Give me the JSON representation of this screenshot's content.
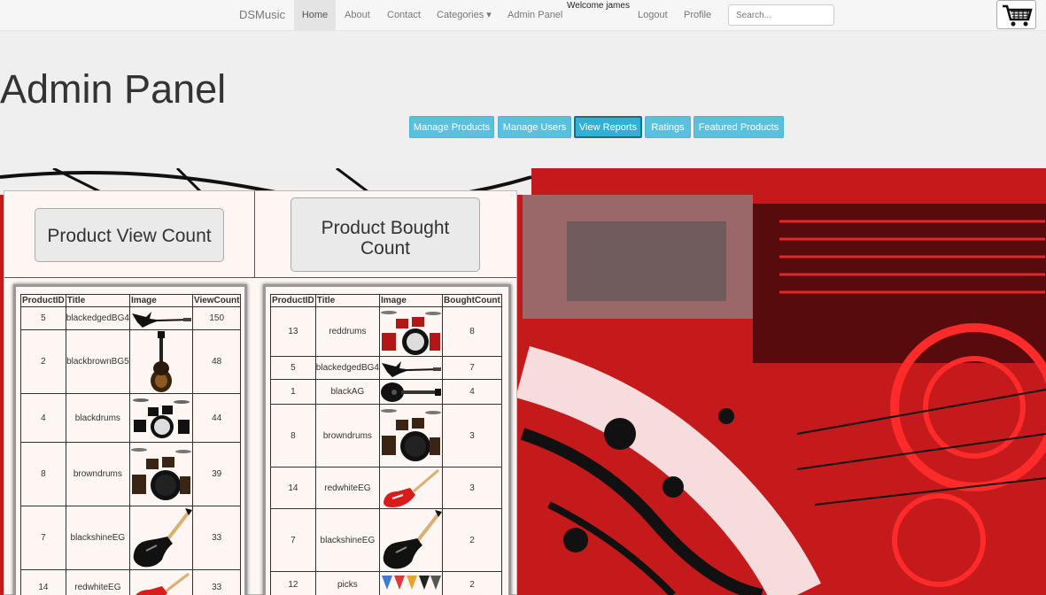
{
  "nav": {
    "brand": "DSMusic",
    "items": [
      {
        "label": "Home"
      },
      {
        "label": "About"
      },
      {
        "label": "Contact"
      },
      {
        "label": "Categories ▾"
      },
      {
        "label": "Admin Panel"
      },
      {
        "label": "Logout"
      },
      {
        "label": "Profile"
      }
    ],
    "welcome": "Welcome james",
    "search_placeholder": "Search..."
  },
  "header": {
    "title": "Admin Panel",
    "buttons": [
      {
        "label": "Manage Products"
      },
      {
        "label": "Manage Users"
      },
      {
        "label": "View Reports"
      },
      {
        "label": "Ratings"
      },
      {
        "label": "Featured Products"
      }
    ]
  },
  "reports": {
    "view_button": "Product View Count",
    "bought_button_line1": "Product Bought",
    "bought_button_line2": "Count",
    "view_table": {
      "headers": [
        "ProductID",
        "Title",
        "Image",
        "ViewCount"
      ],
      "rows": [
        {
          "id": "5",
          "title": "blackedgedBG4",
          "image": "bass-guitar",
          "count": "150"
        },
        {
          "id": "2",
          "title": "blackbrownBG5",
          "image": "bass-upright",
          "count": "48"
        },
        {
          "id": "4",
          "title": "blackdrums",
          "image": "drums",
          "count": "44"
        },
        {
          "id": "8",
          "title": "browndrums",
          "image": "drums",
          "count": "39"
        },
        {
          "id": "7",
          "title": "blackshineEG",
          "image": "electric-guitar",
          "count": "33"
        },
        {
          "id": "14",
          "title": "redwhiteEG",
          "image": "red-guitar",
          "count": "33"
        }
      ]
    },
    "bought_table": {
      "headers": [
        "ProductID",
        "Title",
        "Image",
        "BoughtCount"
      ],
      "rows": [
        {
          "id": "13",
          "title": "reddrums",
          "image": "drums",
          "count": "8"
        },
        {
          "id": "5",
          "title": "blackedgedBG4",
          "image": "bass-guitar",
          "count": "7"
        },
        {
          "id": "1",
          "title": "blackAG",
          "image": "acoustic-guitar",
          "count": "4"
        },
        {
          "id": "8",
          "title": "browndrums",
          "image": "drums",
          "count": "3"
        },
        {
          "id": "14",
          "title": "redwhiteEG",
          "image": "red-guitar",
          "count": "3"
        },
        {
          "id": "7",
          "title": "blackshineEG",
          "image": "electric-guitar",
          "count": "2"
        },
        {
          "id": "12",
          "title": "picks",
          "image": "picks",
          "count": "2"
        }
      ]
    }
  },
  "colors": {
    "accent": "#5bc0de",
    "background_art": "#c0191b"
  }
}
